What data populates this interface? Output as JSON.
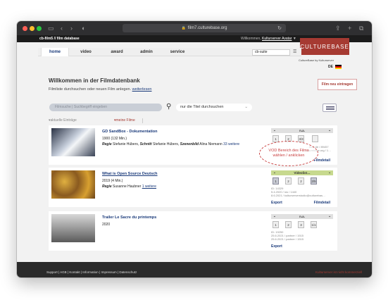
{
  "browser": {
    "url": "film7.culturebase.org",
    "colors": {
      "close": "#ff5f57",
      "min": "#febc2e",
      "max": "#28c840"
    }
  },
  "topnav": {
    "brand": "cb-film5 // film database",
    "welcome_prefix": "Willkommen,",
    "user": "Kulturserver Avatar",
    "caret": "▼"
  },
  "logo": "CULTUREBASE",
  "subtitle": "CultureBase by Kulturserver",
  "menu": [
    "home",
    "video",
    "award",
    "admin",
    "service"
  ],
  "suite": "cb-suite",
  "lang": "DE",
  "welcome": {
    "title": "Willkommen in der Filmdatenbank",
    "text": "Filmliste durchsuchen oder neuen Film anlegen.",
    "link": "weiterlesen"
  },
  "new_film_button": "Film neu eintragen",
  "search": {
    "placeholder": "Filmsuche | Suchbegriff eingeben",
    "scope": "nur die Titel durchsuchen"
  },
  "filters": {
    "current": "aktuelle Einträge",
    "mine": "meine Filme"
  },
  "films": [
    {
      "title": "GD SandBox - Dokumentation",
      "line1": "1900 (132 Min.)",
      "regie_label": "Regie",
      "regie": "Stefanie Hübers,",
      "schnitt_label": "Schnitt",
      "schnitt": "Stefanie Hübers,",
      "szenen_label": "Szenenbild",
      "szenen": "Alina Niemann",
      "more": "33 weitere",
      "vod_head": "n.a.",
      "icons": [
        "1",
        "2",
        "3/3",
        ""
      ],
      "ids": [
        "ID: 60…",
        "29.04…",
        "29.04…"
      ],
      "ids_right": [
        "…tbox.de / 89457",
        "…culturebase.org / 1…"
      ],
      "detail": "Filmdetail"
    },
    {
      "title": "What is Open Source Deutsch",
      "line1": "2019 (4 Min.)",
      "regie_label": "Regie",
      "regie": "Susanne Haubner",
      "more": "1 weitere",
      "vod_head": "Videolist…",
      "icons": [
        "1",
        "2",
        "2",
        "2/5"
      ],
      "ids": [
        "ID: 14329",
        "5.4.2020 / ios / 1440",
        "8.6.2021 / kulturserverstudio@culturebas…"
      ],
      "export": "Export",
      "detail": "Filmdetail"
    },
    {
      "title": "Trailer Le Sacre du printemps",
      "line1": "2020",
      "vod_head": "n.a.",
      "icons": [
        "1",
        "2",
        "3",
        "1/1"
      ],
      "ids": [
        "ID: 19250",
        "25.6.2021 / partner / 1515",
        "25.6.2021 / partner / 1515"
      ],
      "export": "Export"
    }
  ],
  "annotation": "VOD Bereich des Films\nwählen / anklicken",
  "footer": {
    "links": "Support | AGB | Kontakt | Information | Impressum | Datenschutz",
    "right": "Kulturserver ist nicht kommerziell"
  }
}
